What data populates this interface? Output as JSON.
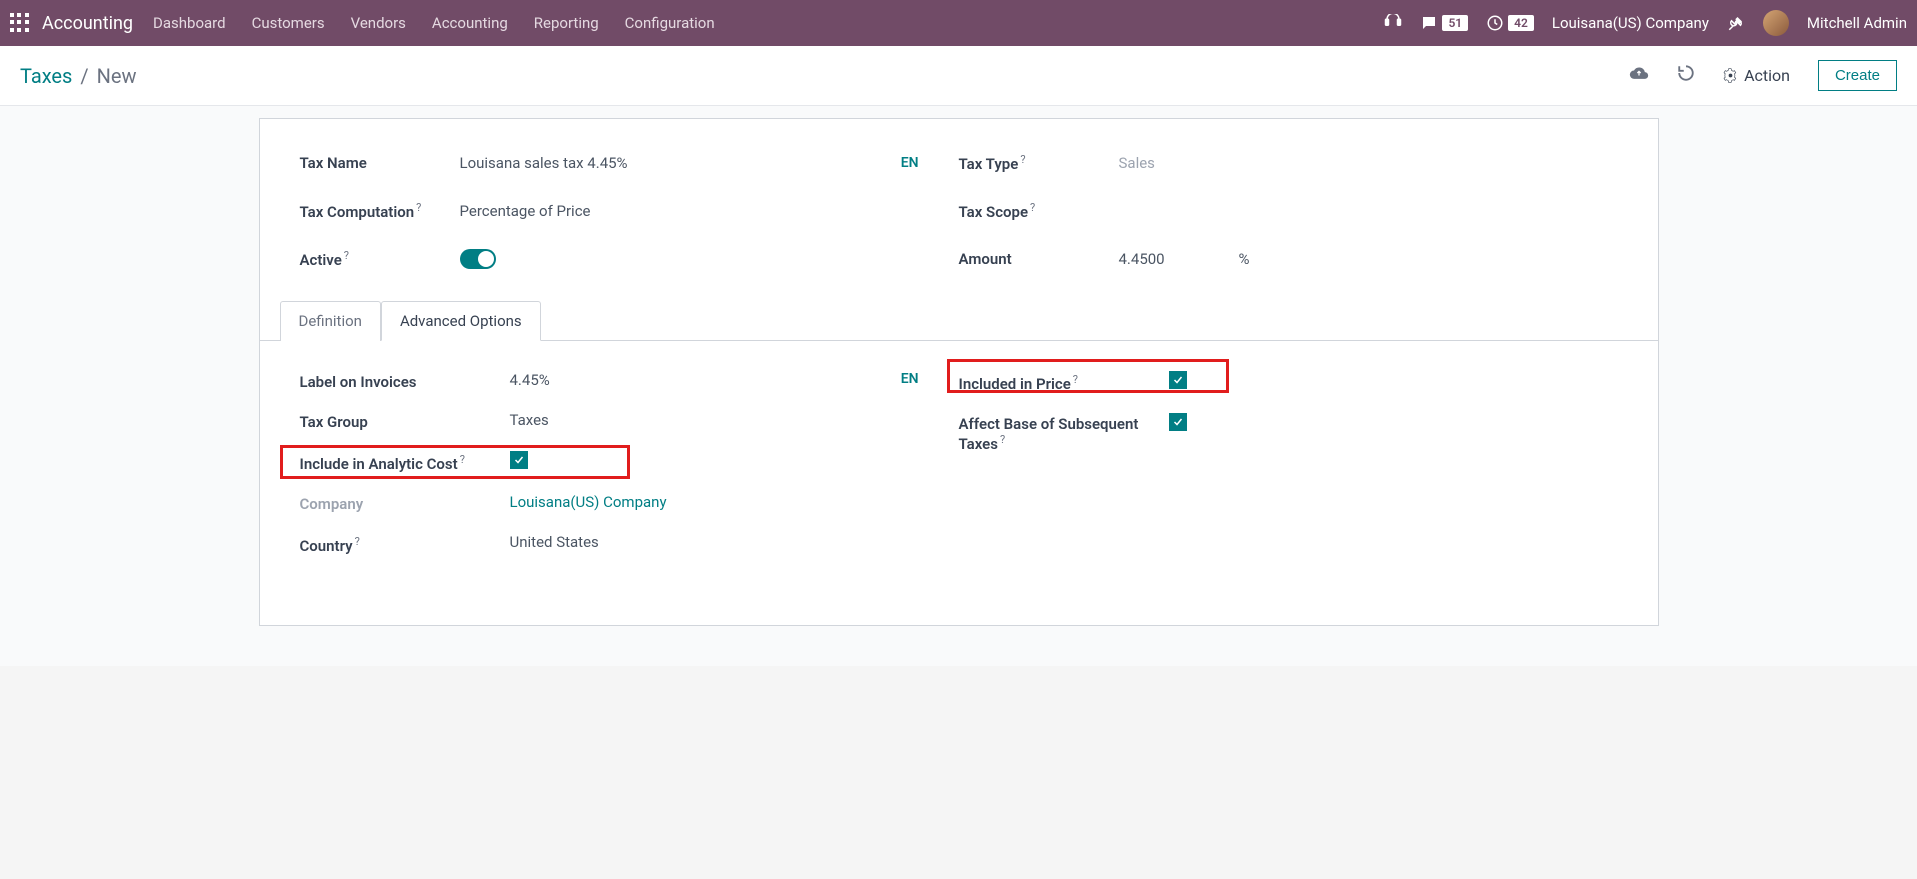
{
  "navbar": {
    "brand": "Accounting",
    "menu": [
      "Dashboard",
      "Customers",
      "Vendors",
      "Accounting",
      "Reporting",
      "Configuration"
    ],
    "msg_badge": "51",
    "clock_badge": "42",
    "company": "Louisana(US) Company",
    "user": "Mitchell Admin"
  },
  "breadcrumb": {
    "parent": "Taxes",
    "current": "New"
  },
  "controls": {
    "action": "Action",
    "create": "Create"
  },
  "form": {
    "tax_name_label": "Tax Name",
    "tax_name_value": "Louisana sales tax 4.45%",
    "tax_computation_label": "Tax Computation",
    "tax_computation_value": "Percentage of Price",
    "active_label": "Active",
    "tax_type_label": "Tax Type",
    "tax_type_value": "Sales",
    "tax_scope_label": "Tax Scope",
    "amount_label": "Amount",
    "amount_value": "4.4500",
    "amount_unit": "%",
    "lang": "EN"
  },
  "tabs": {
    "definition": "Definition",
    "advanced": "Advanced Options"
  },
  "advanced": {
    "label_invoices_label": "Label on Invoices",
    "label_invoices_value": "4.45%",
    "tax_group_label": "Tax Group",
    "tax_group_value": "Taxes",
    "include_analytic_label": "Include in Analytic Cost",
    "company_label": "Company",
    "company_value": "Louisana(US) Company",
    "country_label": "Country",
    "country_value": "United States",
    "included_price_label": "Included in Price",
    "affect_base_label": "Affect Base of Subsequent Taxes",
    "lang": "EN"
  }
}
